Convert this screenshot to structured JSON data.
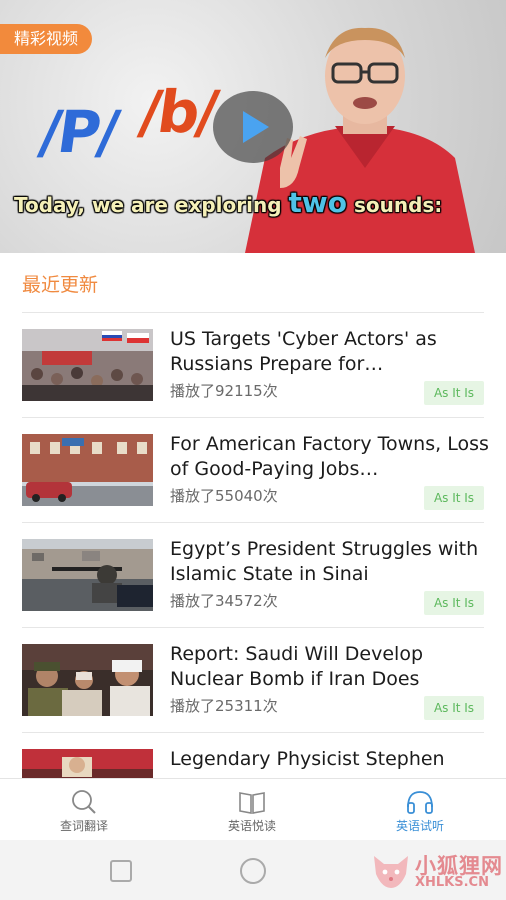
{
  "banner": {
    "badge": "精彩视频",
    "phoneme_p": "/P/",
    "phoneme_b": "/b/",
    "subtitle_pre": "Today, we are exploring ",
    "subtitle_hl": "two",
    "subtitle_post": " sounds:"
  },
  "section": {
    "title": "最近更新"
  },
  "articles": [
    {
      "title": "US Targets 'Cyber Actors' as Russians Prepare for…",
      "plays": "播放了92115次",
      "tag": "As It Is"
    },
    {
      "title": "For American Factory Towns, Loss of Good-Paying Jobs…",
      "plays": "播放了55040次",
      "tag": "As It Is"
    },
    {
      "title": "Egypt’s President Struggles with Islamic State in Sinai",
      "plays": "播放了34572次",
      "tag": "As It Is"
    },
    {
      "title": "Report: Saudi Will Develop Nuclear Bomb if Iran Does",
      "plays": "播放了25311次",
      "tag": "As It Is"
    },
    {
      "title": "Legendary Physicist Stephen",
      "plays": "",
      "tag": ""
    }
  ],
  "nav": {
    "lookup": "查词翻译",
    "reading": "英语悦读",
    "listening": "英语试听"
  },
  "watermark": {
    "name": "小狐狸网",
    "url": "XHLKS.CN"
  },
  "colors": {
    "accent_orange": "#f08a40",
    "active_blue": "#3a8fd6",
    "tag_green": "#5cb85c"
  }
}
